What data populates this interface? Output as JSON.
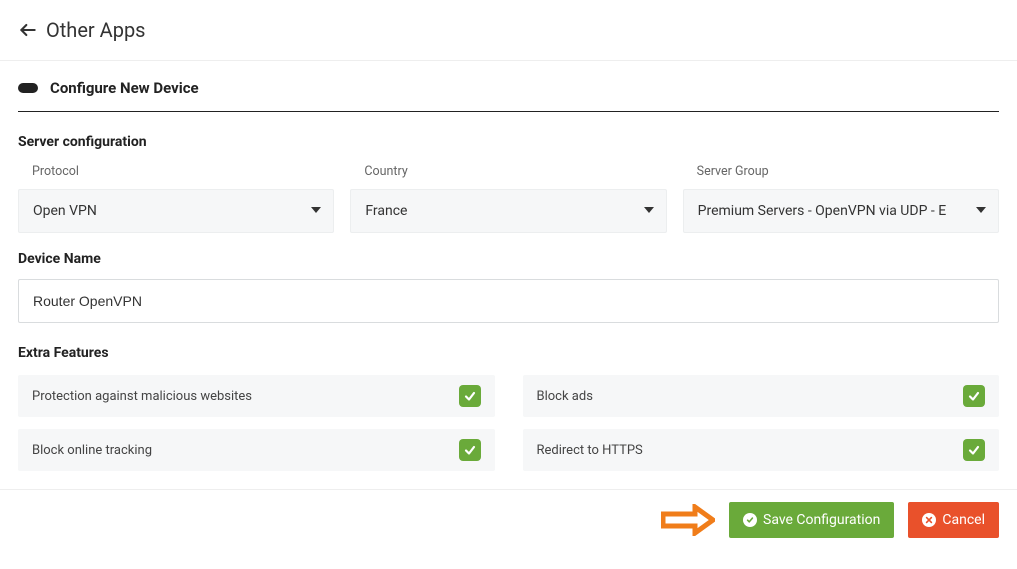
{
  "header": {
    "title": "Other Apps"
  },
  "section": {
    "title": "Configure New Device"
  },
  "server": {
    "group_label": "Server configuration",
    "protocol_label": "Protocol",
    "protocol_value": "Open VPN",
    "country_label": "Country",
    "country_value": "France",
    "server_group_label": "Server Group",
    "server_group_value": "Premium Servers - OpenVPN via UDP - E"
  },
  "device": {
    "label": "Device Name",
    "value": "Router OpenVPN"
  },
  "features": {
    "label": "Extra Features",
    "items": [
      {
        "label": "Protection against malicious websites",
        "checked": true
      },
      {
        "label": "Block ads",
        "checked": true
      },
      {
        "label": "Block online tracking",
        "checked": true
      },
      {
        "label": "Redirect to HTTPS",
        "checked": true
      }
    ]
  },
  "actions": {
    "save": "Save Configuration",
    "cancel": "Cancel"
  },
  "colors": {
    "green": "#6aaa3a",
    "orange": "#e9512b",
    "arrow": "#f07d1a"
  }
}
